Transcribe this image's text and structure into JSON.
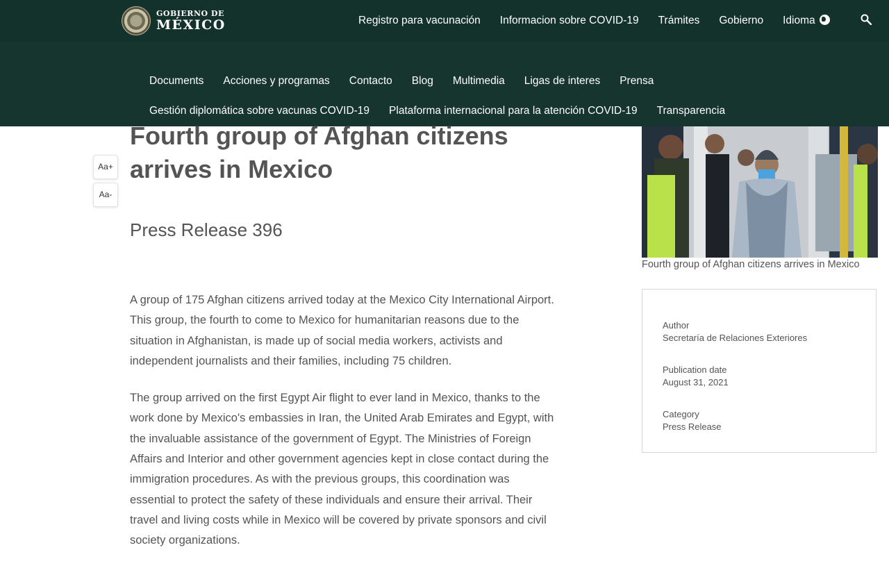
{
  "header": {
    "logo_small": "GOBIERNO DE",
    "logo_big": "MÉXICO",
    "nav": [
      "Registro para vacunación",
      "Informacion sobre COVID-19",
      "Trámites",
      "Gobierno",
      "Idioma"
    ]
  },
  "subnav": {
    "row1": [
      "Documents",
      "Acciones y programas",
      "Contacto",
      "Blog",
      "Multimedia",
      "Ligas de interes",
      "Prensa"
    ],
    "row2": [
      "Gestión diplomática sobre vacunas COVID-19",
      "Plataforma internacional para la atención COVID-19",
      "Transparencia"
    ]
  },
  "font_controls": {
    "increase": "Aa+",
    "decrease": "Aa-"
  },
  "article": {
    "title": "Fourth group of Afghan citizens arrives in Mexico",
    "subtitle": "Press Release 396",
    "paragraphs": [
      "A group of 175 Afghan citizens arrived today at the Mexico City International Airport. This group, the fourth to come to Mexico for humanitarian reasons due to the situation in Afghanistan, is made up of social media workers, activists and independent journalists and their families, including 75 children.",
      "The group arrived on the first Egypt Air flight to ever land in Mexico, thanks to the work done by Mexico's embassies in Iran, the United Arab Emirates and Egypt, with the invaluable assistance of the government of Egypt.  The Ministries of Foreign Affairs and Interior and other government agencies kept in close contact during the immigration procedures.  As with the previous groups, this coordination was essential to protect the safety of these individuals and ensure their arrival.  Their travel and living costs while in Mexico will be covered by private sponsors and civil society organizations."
    ]
  },
  "sidebar": {
    "photo_caption": "Fourth group of Afghan citizens arrives in Mexico",
    "author_label": "Author",
    "author_value": "Secretaría de Relaciones Exteriores",
    "date_label": "Publication date",
    "date_value": "August 31, 2021",
    "category_label": "Category",
    "category_value": "Press Release"
  },
  "colors": {
    "header_bg": "#13322b",
    "subnav_bg": "#15352e",
    "text": "#545454"
  }
}
